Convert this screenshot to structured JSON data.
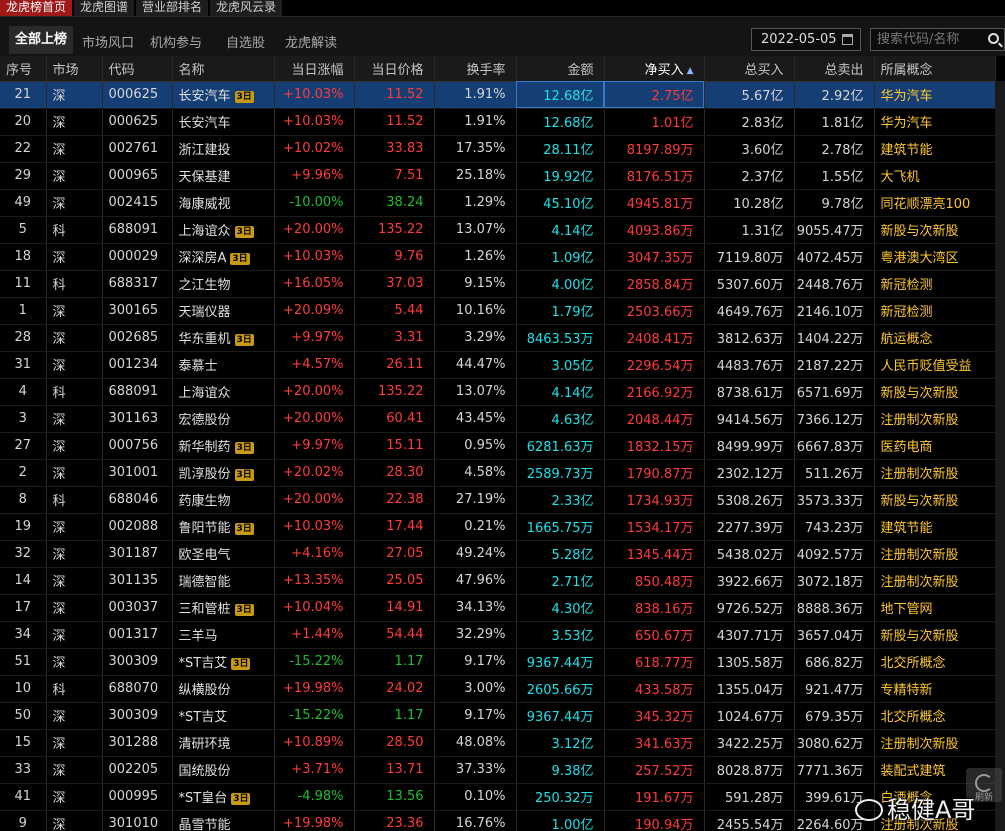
{
  "top_tabs": [
    "龙虎榜首页",
    "龙虎图谱",
    "营业部排名",
    "龙虎风云录"
  ],
  "sub_tabs": [
    "全部上榜",
    "市场风口",
    "机构参与",
    "自选股",
    "龙虎解读"
  ],
  "date": "2022-05-05",
  "search_placeholder": "搜索代码/名称",
  "columns": [
    "序号",
    "市场",
    "代码",
    "名称",
    "当日涨幅",
    "当日价格",
    "换手率",
    "金额",
    "净买入",
    "总买入",
    "总卖出",
    "所属概念"
  ],
  "badge_label": "3日",
  "refresh_label": "刷新",
  "watermark": "稳健A哥",
  "rows": [
    {
      "seq": "21",
      "market": "深",
      "code": "000625",
      "name": "长安汽车",
      "badge": true,
      "change": "+10.03%",
      "dir": "up",
      "price": "11.52",
      "turnover": "1.91%",
      "amount": "12.68亿",
      "net_buy": "2.75亿",
      "total_buy": "5.67亿",
      "total_sell": "2.92亿",
      "concept": "华为汽车"
    },
    {
      "seq": "20",
      "market": "深",
      "code": "000625",
      "name": "长安汽车",
      "badge": false,
      "change": "+10.03%",
      "dir": "up",
      "price": "11.52",
      "turnover": "1.91%",
      "amount": "12.68亿",
      "net_buy": "1.01亿",
      "total_buy": "2.83亿",
      "total_sell": "1.81亿",
      "concept": "华为汽车"
    },
    {
      "seq": "22",
      "market": "深",
      "code": "002761",
      "name": "浙江建投",
      "badge": false,
      "change": "+10.02%",
      "dir": "up",
      "price": "33.83",
      "turnover": "17.35%",
      "amount": "28.11亿",
      "net_buy": "8197.89万",
      "total_buy": "3.60亿",
      "total_sell": "2.78亿",
      "concept": "建筑节能"
    },
    {
      "seq": "29",
      "market": "深",
      "code": "000965",
      "name": "天保基建",
      "badge": false,
      "change": "+9.96%",
      "dir": "up",
      "price": "7.51",
      "turnover": "25.18%",
      "amount": "19.92亿",
      "net_buy": "8176.51万",
      "total_buy": "2.37亿",
      "total_sell": "1.55亿",
      "concept": "大飞机"
    },
    {
      "seq": "49",
      "market": "深",
      "code": "002415",
      "name": "海康威视",
      "badge": false,
      "change": "-10.00%",
      "dir": "down",
      "price": "38.24",
      "turnover": "1.29%",
      "amount": "45.10亿",
      "net_buy": "4945.81万",
      "total_buy": "10.28亿",
      "total_sell": "9.78亿",
      "concept": "同花顺漂亮100"
    },
    {
      "seq": "5",
      "market": "科",
      "code": "688091",
      "name": "上海谊众",
      "badge": true,
      "change": "+20.00%",
      "dir": "up",
      "price": "135.22",
      "turnover": "13.07%",
      "amount": "4.14亿",
      "net_buy": "4093.86万",
      "total_buy": "1.31亿",
      "total_sell": "9055.47万",
      "concept": "新股与次新股"
    },
    {
      "seq": "18",
      "market": "深",
      "code": "000029",
      "name": "深深房A",
      "badge": true,
      "change": "+10.03%",
      "dir": "up",
      "price": "9.76",
      "turnover": "1.26%",
      "amount": "1.09亿",
      "net_buy": "3047.35万",
      "total_buy": "7119.80万",
      "total_sell": "4072.45万",
      "concept": "粤港澳大湾区"
    },
    {
      "seq": "11",
      "market": "科",
      "code": "688317",
      "name": "之江生物",
      "badge": false,
      "change": "+16.05%",
      "dir": "up",
      "price": "37.03",
      "turnover": "9.15%",
      "amount": "4.00亿",
      "net_buy": "2858.84万",
      "total_buy": "5307.60万",
      "total_sell": "2448.76万",
      "concept": "新冠检测"
    },
    {
      "seq": "1",
      "market": "深",
      "code": "300165",
      "name": "天瑞仪器",
      "badge": false,
      "change": "+20.09%",
      "dir": "up",
      "price": "5.44",
      "turnover": "10.16%",
      "amount": "1.79亿",
      "net_buy": "2503.66万",
      "total_buy": "4649.76万",
      "total_sell": "2146.10万",
      "concept": "新冠检测"
    },
    {
      "seq": "28",
      "market": "深",
      "code": "002685",
      "name": "华东重机",
      "badge": true,
      "change": "+9.97%",
      "dir": "up",
      "price": "3.31",
      "turnover": "3.29%",
      "amount": "8463.53万",
      "net_buy": "2408.41万",
      "total_buy": "3812.63万",
      "total_sell": "1404.22万",
      "concept": "航运概念"
    },
    {
      "seq": "31",
      "market": "深",
      "code": "001234",
      "name": "泰慕士",
      "badge": false,
      "change": "+4.57%",
      "dir": "up",
      "price": "26.11",
      "turnover": "44.47%",
      "amount": "3.05亿",
      "net_buy": "2296.54万",
      "total_buy": "4483.76万",
      "total_sell": "2187.22万",
      "concept": "人民币贬值受益"
    },
    {
      "seq": "4",
      "market": "科",
      "code": "688091",
      "name": "上海谊众",
      "badge": false,
      "change": "+20.00%",
      "dir": "up",
      "price": "135.22",
      "turnover": "13.07%",
      "amount": "4.14亿",
      "net_buy": "2166.92万",
      "total_buy": "8738.61万",
      "total_sell": "6571.69万",
      "concept": "新股与次新股"
    },
    {
      "seq": "3",
      "market": "深",
      "code": "301163",
      "name": "宏德股份",
      "badge": false,
      "change": "+20.00%",
      "dir": "up",
      "price": "60.41",
      "turnover": "43.45%",
      "amount": "4.63亿",
      "net_buy": "2048.44万",
      "total_buy": "9414.56万",
      "total_sell": "7366.12万",
      "concept": "注册制次新股"
    },
    {
      "seq": "27",
      "market": "深",
      "code": "000756",
      "name": "新华制药",
      "badge": true,
      "change": "+9.97%",
      "dir": "up",
      "price": "15.11",
      "turnover": "0.95%",
      "amount": "6281.63万",
      "net_buy": "1832.15万",
      "total_buy": "8499.99万",
      "total_sell": "6667.83万",
      "concept": "医药电商"
    },
    {
      "seq": "2",
      "market": "深",
      "code": "301001",
      "name": "凯淳股份",
      "badge": true,
      "change": "+20.02%",
      "dir": "up",
      "price": "28.30",
      "turnover": "4.58%",
      "amount": "2589.73万",
      "net_buy": "1790.87万",
      "total_buy": "2302.12万",
      "total_sell": "511.26万",
      "concept": "注册制次新股"
    },
    {
      "seq": "8",
      "market": "科",
      "code": "688046",
      "name": "药康生物",
      "badge": false,
      "change": "+20.00%",
      "dir": "up",
      "price": "22.38",
      "turnover": "27.19%",
      "amount": "2.33亿",
      "net_buy": "1734.93万",
      "total_buy": "5308.26万",
      "total_sell": "3573.33万",
      "concept": "新股与次新股"
    },
    {
      "seq": "19",
      "market": "深",
      "code": "002088",
      "name": "鲁阳节能",
      "badge": true,
      "change": "+10.03%",
      "dir": "up",
      "price": "17.44",
      "turnover": "0.21%",
      "amount": "1665.75万",
      "net_buy": "1534.17万",
      "total_buy": "2277.39万",
      "total_sell": "743.23万",
      "concept": "建筑节能"
    },
    {
      "seq": "32",
      "market": "深",
      "code": "301187",
      "name": "欧圣电气",
      "badge": false,
      "change": "+4.16%",
      "dir": "up",
      "price": "27.05",
      "turnover": "49.24%",
      "amount": "5.28亿",
      "net_buy": "1345.44万",
      "total_buy": "5438.02万",
      "total_sell": "4092.57万",
      "concept": "注册制次新股"
    },
    {
      "seq": "14",
      "market": "深",
      "code": "301135",
      "name": "瑞德智能",
      "badge": false,
      "change": "+13.35%",
      "dir": "up",
      "price": "25.05",
      "turnover": "47.96%",
      "amount": "2.71亿",
      "net_buy": "850.48万",
      "total_buy": "3922.66万",
      "total_sell": "3072.18万",
      "concept": "注册制次新股"
    },
    {
      "seq": "17",
      "market": "深",
      "code": "003037",
      "name": "三和管桩",
      "badge": true,
      "change": "+10.04%",
      "dir": "up",
      "price": "14.91",
      "turnover": "34.13%",
      "amount": "4.30亿",
      "net_buy": "838.16万",
      "total_buy": "9726.52万",
      "total_sell": "8888.36万",
      "concept": "地下管网"
    },
    {
      "seq": "34",
      "market": "深",
      "code": "001317",
      "name": "三羊马",
      "badge": false,
      "change": "+1.44%",
      "dir": "up",
      "price": "54.44",
      "turnover": "32.29%",
      "amount": "3.53亿",
      "net_buy": "650.67万",
      "total_buy": "4307.71万",
      "total_sell": "3657.04万",
      "concept": "新股与次新股"
    },
    {
      "seq": "51",
      "market": "深",
      "code": "300309",
      "name": "*ST吉艾",
      "badge": true,
      "change": "-15.22%",
      "dir": "down",
      "price": "1.17",
      "turnover": "9.17%",
      "amount": "9367.44万",
      "net_buy": "618.77万",
      "total_buy": "1305.58万",
      "total_sell": "686.82万",
      "concept": "北交所概念"
    },
    {
      "seq": "10",
      "market": "科",
      "code": "688070",
      "name": "纵横股份",
      "badge": false,
      "change": "+19.98%",
      "dir": "up",
      "price": "24.02",
      "turnover": "3.00%",
      "amount": "2605.66万",
      "net_buy": "433.58万",
      "total_buy": "1355.04万",
      "total_sell": "921.47万",
      "concept": "专精特新"
    },
    {
      "seq": "50",
      "market": "深",
      "code": "300309",
      "name": "*ST吉艾",
      "badge": false,
      "change": "-15.22%",
      "dir": "down",
      "price": "1.17",
      "turnover": "9.17%",
      "amount": "9367.44万",
      "net_buy": "345.32万",
      "total_buy": "1024.67万",
      "total_sell": "679.35万",
      "concept": "北交所概念"
    },
    {
      "seq": "15",
      "market": "深",
      "code": "301288",
      "name": "清研环境",
      "badge": false,
      "change": "+10.89%",
      "dir": "up",
      "price": "28.50",
      "turnover": "48.08%",
      "amount": "3.12亿",
      "net_buy": "341.63万",
      "total_buy": "3422.25万",
      "total_sell": "3080.62万",
      "concept": "注册制次新股"
    },
    {
      "seq": "33",
      "market": "深",
      "code": "002205",
      "name": "国统股份",
      "badge": false,
      "change": "+3.71%",
      "dir": "up",
      "price": "13.71",
      "turnover": "37.33%",
      "amount": "9.38亿",
      "net_buy": "257.52万",
      "total_buy": "8028.87万",
      "total_sell": "7771.36万",
      "concept": "装配式建筑"
    },
    {
      "seq": "41",
      "market": "深",
      "code": "000995",
      "name": "*ST皇台",
      "badge": true,
      "change": "-4.98%",
      "dir": "down",
      "price": "13.56",
      "turnover": "0.10%",
      "amount": "250.32万",
      "net_buy": "191.67万",
      "total_buy": "591.28万",
      "total_sell": "399.61万",
      "concept": "白酒概念"
    },
    {
      "seq": "9",
      "market": "深",
      "code": "301010",
      "name": "晶雪节能",
      "badge": false,
      "change": "+19.98%",
      "dir": "up",
      "price": "23.36",
      "turnover": "16.76%",
      "amount": "1.00亿",
      "net_buy": "190.94万",
      "total_buy": "2455.54万",
      "total_sell": "2264.60万",
      "concept": "注册制次新股"
    }
  ]
}
